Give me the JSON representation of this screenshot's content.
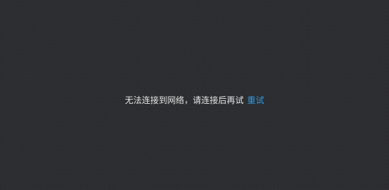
{
  "error": {
    "message": "无法连接到网络，请连接后再试",
    "retry_label": "重试"
  },
  "colors": {
    "background": "#2a2b2e",
    "text": "#e6e6e6",
    "link": "#2f9be0"
  }
}
